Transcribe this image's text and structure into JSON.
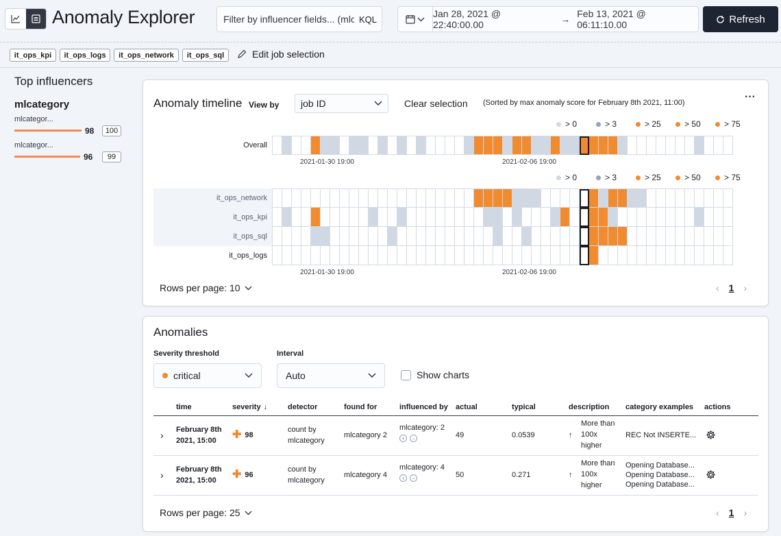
{
  "header": {
    "title": "Anomaly Explorer",
    "query_placeholder": "Filter by influencer fields... (mlc",
    "kql_label": "KQL",
    "date_from": "Jan 28, 2021 @ 22:40:00.00",
    "arrow": "→",
    "date_to": "Feb 13, 2021 @ 06:11:10.00",
    "refresh_label": "Refresh"
  },
  "jobs": {
    "badges": [
      "it_ops_kpi",
      "it_ops_logs",
      "it_ops_network",
      "it_ops_sql"
    ],
    "edit_label": "Edit job selection"
  },
  "influencers": {
    "title": "Top influencers",
    "field": "mlcategory",
    "items": [
      {
        "label": "mlcategor...",
        "value": "98",
        "max": "100"
      },
      {
        "label": "mlcategor...",
        "value": "96",
        "max": "99"
      }
    ]
  },
  "timeline": {
    "title": "Anomaly timeline",
    "view_by_label": "View by",
    "view_by_value": "job ID",
    "clear_selection": "Clear selection",
    "sort_note": "(Sorted by max anomaly score for February 8th 2021, 11:00)",
    "menu": "···",
    "legend": [
      "> 0",
      "> 3",
      "> 25",
      "> 50",
      "> 75"
    ],
    "legend_colors": [
      "#d0d8e4",
      "#98a2b3",
      "#f08b2f",
      "#f08b2f",
      "#f08b2f"
    ],
    "overall_label": "Overall",
    "axis_labels": [
      "2021-01-30 19:00",
      "2021-02-06 19:00"
    ],
    "rows": [
      {
        "label": "it_ops_network",
        "bold": false
      },
      {
        "label": "it_ops_kpi",
        "bold": false
      },
      {
        "label": "it_ops_sql",
        "bold": false
      },
      {
        "label": "it_ops_logs",
        "bold": true
      }
    ],
    "rows_per_page": "Rows per page: 10",
    "page": "1",
    "overall_cells": [
      0,
      1,
      0,
      0,
      3,
      1,
      1,
      0,
      1,
      1,
      0,
      1,
      0,
      1,
      0,
      1,
      0,
      0,
      0,
      0,
      1,
      3,
      3,
      3,
      1,
      3,
      3,
      1,
      1,
      3,
      1,
      1,
      3,
      3,
      3,
      3,
      1,
      0,
      0,
      0,
      0,
      0,
      0,
      0,
      1,
      0,
      0,
      0
    ],
    "swim_cells": [
      [
        0,
        0,
        0,
        0,
        0,
        0,
        0,
        0,
        0,
        0,
        0,
        0,
        0,
        0,
        0,
        0,
        0,
        0,
        0,
        0,
        0,
        3,
        3,
        3,
        3,
        1,
        1,
        1,
        0,
        0,
        0,
        0,
        0,
        3,
        1,
        3,
        3,
        1,
        1,
        0,
        0,
        0,
        0,
        0,
        0,
        0,
        0,
        0
      ],
      [
        0,
        1,
        0,
        0,
        3,
        0,
        0,
        0,
        0,
        0,
        1,
        0,
        0,
        1,
        0,
        0,
        0,
        0,
        0,
        0,
        0,
        0,
        1,
        1,
        0,
        1,
        0,
        0,
        0,
        1,
        3,
        0,
        0,
        3,
        3,
        1,
        0,
        0,
        0,
        0,
        0,
        0,
        0,
        0,
        1,
        0,
        0,
        0
      ],
      [
        0,
        0,
        0,
        0,
        1,
        1,
        0,
        0,
        0,
        0,
        0,
        0,
        1,
        0,
        0,
        0,
        0,
        0,
        0,
        0,
        0,
        0,
        0,
        1,
        0,
        0,
        1,
        0,
        0,
        0,
        0,
        0,
        0,
        3,
        3,
        3,
        3,
        0,
        0,
        0,
        0,
        0,
        0,
        0,
        0,
        0,
        0,
        0
      ],
      [
        0,
        0,
        0,
        0,
        0,
        0,
        0,
        0,
        0,
        0,
        0,
        0,
        0,
        0,
        0,
        0,
        0,
        0,
        0,
        0,
        0,
        0,
        0,
        0,
        0,
        0,
        0,
        0,
        0,
        0,
        0,
        0,
        0,
        3,
        0,
        0,
        0,
        0,
        0,
        0,
        0,
        0,
        0,
        0,
        0,
        0,
        0,
        0
      ]
    ]
  },
  "anomalies": {
    "title": "Anomalies",
    "severity_label": "Severity threshold",
    "severity_value": "critical",
    "interval_label": "Interval",
    "interval_value": "Auto",
    "show_charts": "Show charts",
    "columns": [
      "time",
      "severity",
      "detector",
      "found for",
      "influenced by",
      "actual",
      "typical",
      "description",
      "category examples",
      "actions"
    ],
    "rows": [
      {
        "time": [
          "February 8th",
          "2021, 15:00"
        ],
        "severity": "98",
        "detector": [
          "count by",
          "mlcategory"
        ],
        "found_for": "mlcategory 2",
        "influenced_by": "mlcategory: 2",
        "actual": "49",
        "typical": "0.0539",
        "description": [
          "More than",
          "100x",
          "higher"
        ],
        "examples": [
          "REC Not INSERTE..."
        ]
      },
      {
        "time": [
          "February 8th",
          "2021, 15:00"
        ],
        "severity": "96",
        "detector": [
          "count by",
          "mlcategory"
        ],
        "found_for": "mlcategory 4",
        "influenced_by": "mlcategory: 4",
        "actual": "50",
        "typical": "0.271",
        "description": [
          "More than",
          "100x",
          "higher"
        ],
        "examples": [
          "Opening Database...",
          "Opening Database...",
          "Opening Database..."
        ]
      }
    ],
    "rows_per_page": "Rows per page: 25",
    "page": "1"
  }
}
